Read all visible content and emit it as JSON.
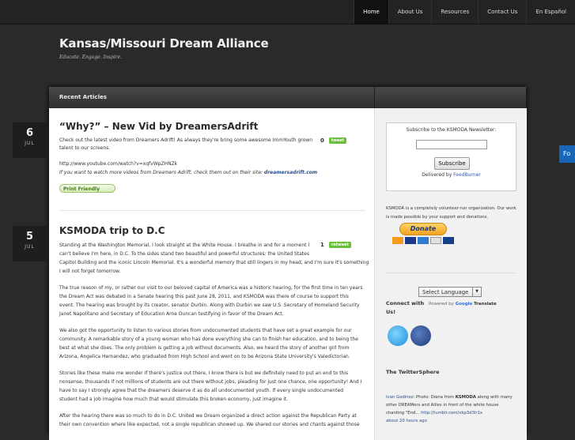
{
  "nav": [
    "Home",
    "About Us",
    "Resources",
    "Contact Us",
    "En Español"
  ],
  "site": {
    "title": "Kansas/Missouri Dream Alliance",
    "tagline": "Educate. Engage. Inspire."
  },
  "section_label": "Recent Articles",
  "posts": [
    {
      "day": "6",
      "month": "JUL",
      "title": "“Why?” – New Vid by DreamersAdrift",
      "p1": "Check out the latest video from Dreamers Adrift! As always they're bring some awesome ImmYouth grown",
      "p1b": "talent to our screens.",
      "url": "http://www.youtube.com/watch?v=xqfvWpZHNZk",
      "p2": "If you want to watch more videos from Dreamers Adrift, check them out on their site: ",
      "p2link": "dreamersadrift.com",
      "tweet_count": "0",
      "tweet_btn": "tweet",
      "print": "Print Friendly"
    },
    {
      "day": "5",
      "month": "JUL",
      "title": "KSMODA trip to D.C",
      "tweet_count": "1",
      "tweet_btn": "retweet",
      "lines": [
        "Standing at the Washington Memorial, I look straight at the White House. I breathe in and for a moment I",
        "can't believe I'm here, in D.C. To the sides stand two beautiful and powerful structures: the United States",
        "Capitol Building and the iconic Lincoln Memorial. It's a wonderful memory that still lingers in my head, and I'm sure it's something",
        "I will not forget tomorrow.",
        "",
        "The true reason of my, or rather our visit to our beloved capital of America was a  historic hearing, for the first time in ten years",
        "the Dream Act was debated in a Senate hearing this past June 28, 2011, and KSMODA was there of course to support this",
        "event. The hearing was brought by its creator, senator Durbin. Along with Durbin we saw U.S. Secretary of Homeland Security",
        "Janet Napolitano and Secretary of Education Arne Duncan testifying in favor of the Dream Act.",
        "",
        "We also got the opportunity to listen to various stories from undocumented students that have set a great example for our",
        "community. A remarkable story of a young woman who has done everything she can to finish her education, and to being the",
        "best at what she does. The only problem is getting a job without documents. Also, we heard the story of another girl from",
        "Arizona, Angelica Hernandez, who graduated from High School and went on to be Arizona State University's Valedictorian.",
        "",
        "Stories like these make me wonder if there's justice out there, I know there is but we definitely need to put an end to this",
        "nonsense, thousands if not millions of students are out there without jobs, pleading for just one chance, one opportunity! And I",
        "have to say I strongly agree that the dreamers deserve it as do all undocumented youth. If every single undocumented",
        "student had a job imagine how much that would stimulate this broken economy, just imagine it.",
        "",
        "After the hearing there was so much to do in D.C. United we Dream organized a direct action against the Republican Party at",
        "their own convention where like expected, not a single republican showed up.  We shared our stories and chants against those"
      ]
    }
  ],
  "sidebar": {
    "newsletter_title": "Subscribe to the KSMODA Newsletter:",
    "subscribe_btn": "Subscribe",
    "delivered": "Delivered by ",
    "feedburner": "FeedBurner",
    "about1": "KSMODA is a completely volunteer-run organization. Our work",
    "about2": "is made possible by your support and donations.",
    "donate": "Donate",
    "select_lang": "Select Language",
    "connect": "Connect with",
    "connect2": "Us!",
    "powered": "Powered by ",
    "google": "Google",
    "translate": "Translate",
    "twittersphere": "The TwitterSphere",
    "tw1a": "Ivan Godinez",
    "tw1b": ": Photo: Diana from ",
    "tw1c": "KSMODA",
    "tw1d": " along with many",
    "tw2": "other DREAMers and Allies in front of the white house",
    "tw3a": "chanting \"End... ",
    "tw3b": "http://tumblr.com/xkp3d3lr1x",
    "tw4": "about 20 hours ago"
  },
  "edge_tab": "Fo"
}
